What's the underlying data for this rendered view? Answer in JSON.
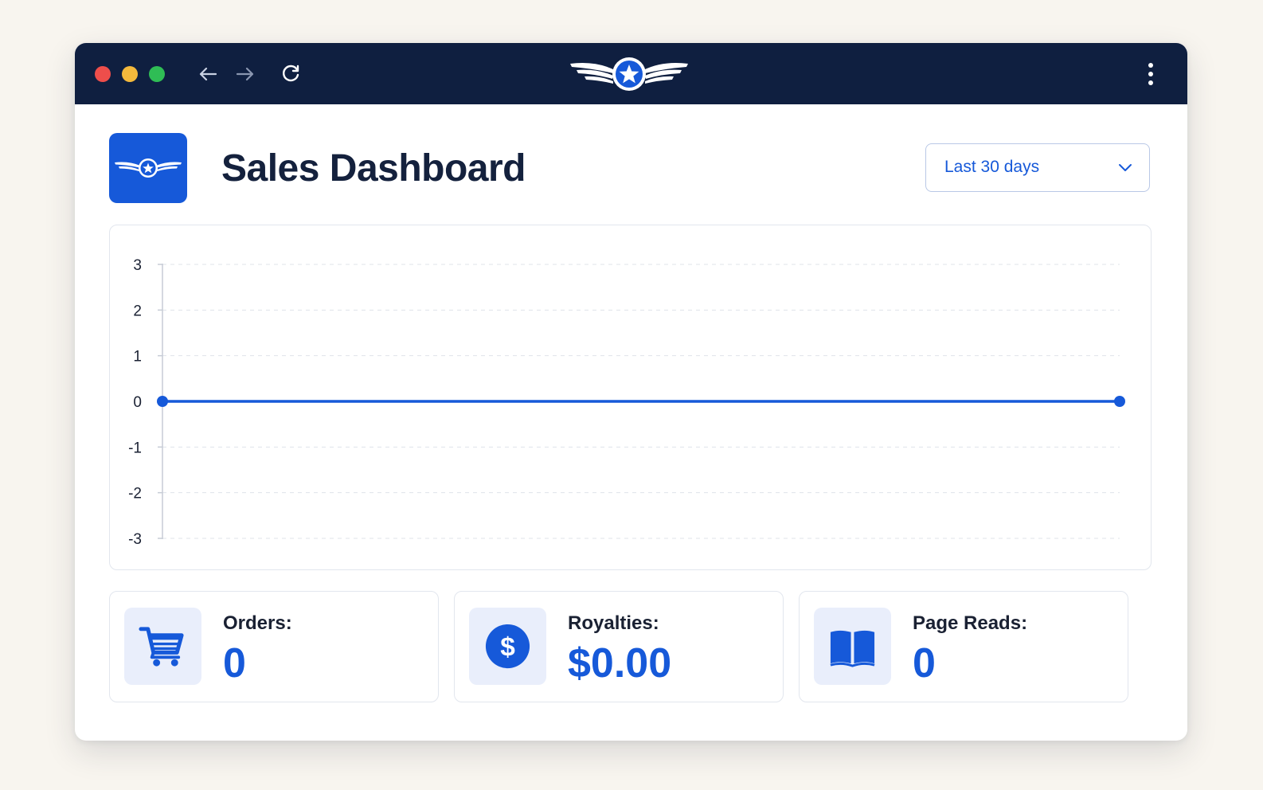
{
  "window": {
    "controls": [
      "close-button",
      "minimize-button",
      "maximize-button"
    ],
    "nav_icons": [
      "arrow-left-icon",
      "arrow-right-icon",
      "reload-icon"
    ],
    "brand_icon": "winged-star-logo-icon",
    "menu_icon": "kebab-menu-icon"
  },
  "colors": {
    "titlebar": "#0f1f40",
    "accent": "#1659d9",
    "heading": "#14213d",
    "card_border": "#e2e6ee",
    "icon_tile": "#e9eefb"
  },
  "header": {
    "title": "Sales Dashboard",
    "app_icon": "winged-star-logo-icon",
    "range_selector": {
      "selected": "Last 30 days",
      "icon": "chevron-down-icon"
    }
  },
  "chart_data": {
    "type": "line",
    "yticks": [
      "3",
      "2",
      "1",
      "0",
      "-1",
      "-2",
      "-3"
    ],
    "ylim": [
      -3,
      3
    ],
    "grid": true,
    "series": [
      {
        "values": [
          0,
          0
        ],
        "color": "#1659d9"
      }
    ]
  },
  "stats": [
    {
      "label": "Orders:",
      "value": "0",
      "icon": "shopping-cart-icon"
    },
    {
      "label": "Royalties:",
      "value": "$0.00",
      "icon": "dollar-coin-icon"
    },
    {
      "label": "Page Reads:",
      "value": "0",
      "icon": "open-book-icon"
    }
  ]
}
